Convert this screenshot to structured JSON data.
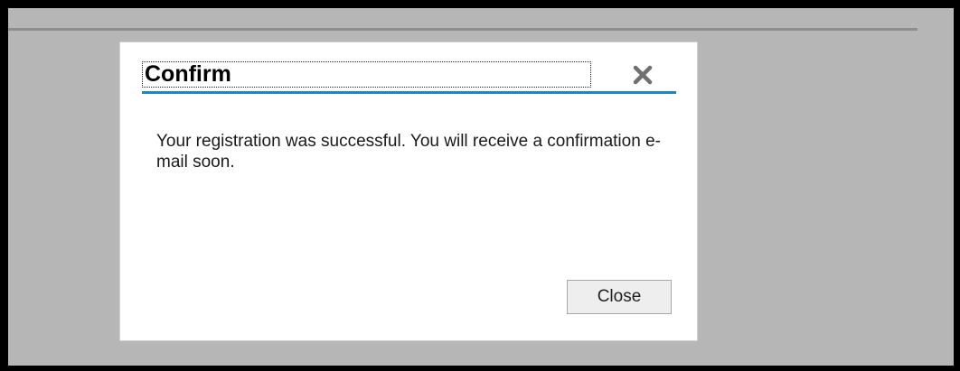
{
  "dialog": {
    "title": "Confirm",
    "message": "Your registration was successful. You will receive a confirmation e-mail soon.",
    "close_button_label": "Close",
    "close_icon": "close-x-icon"
  },
  "colors": {
    "outer_frame": "#000000",
    "backdrop": "#b6b6b6",
    "dialog_background": "#ffffff",
    "header_accent": "#1a86c8",
    "close_icon": "#707070",
    "button_background": "#eeeeee"
  }
}
